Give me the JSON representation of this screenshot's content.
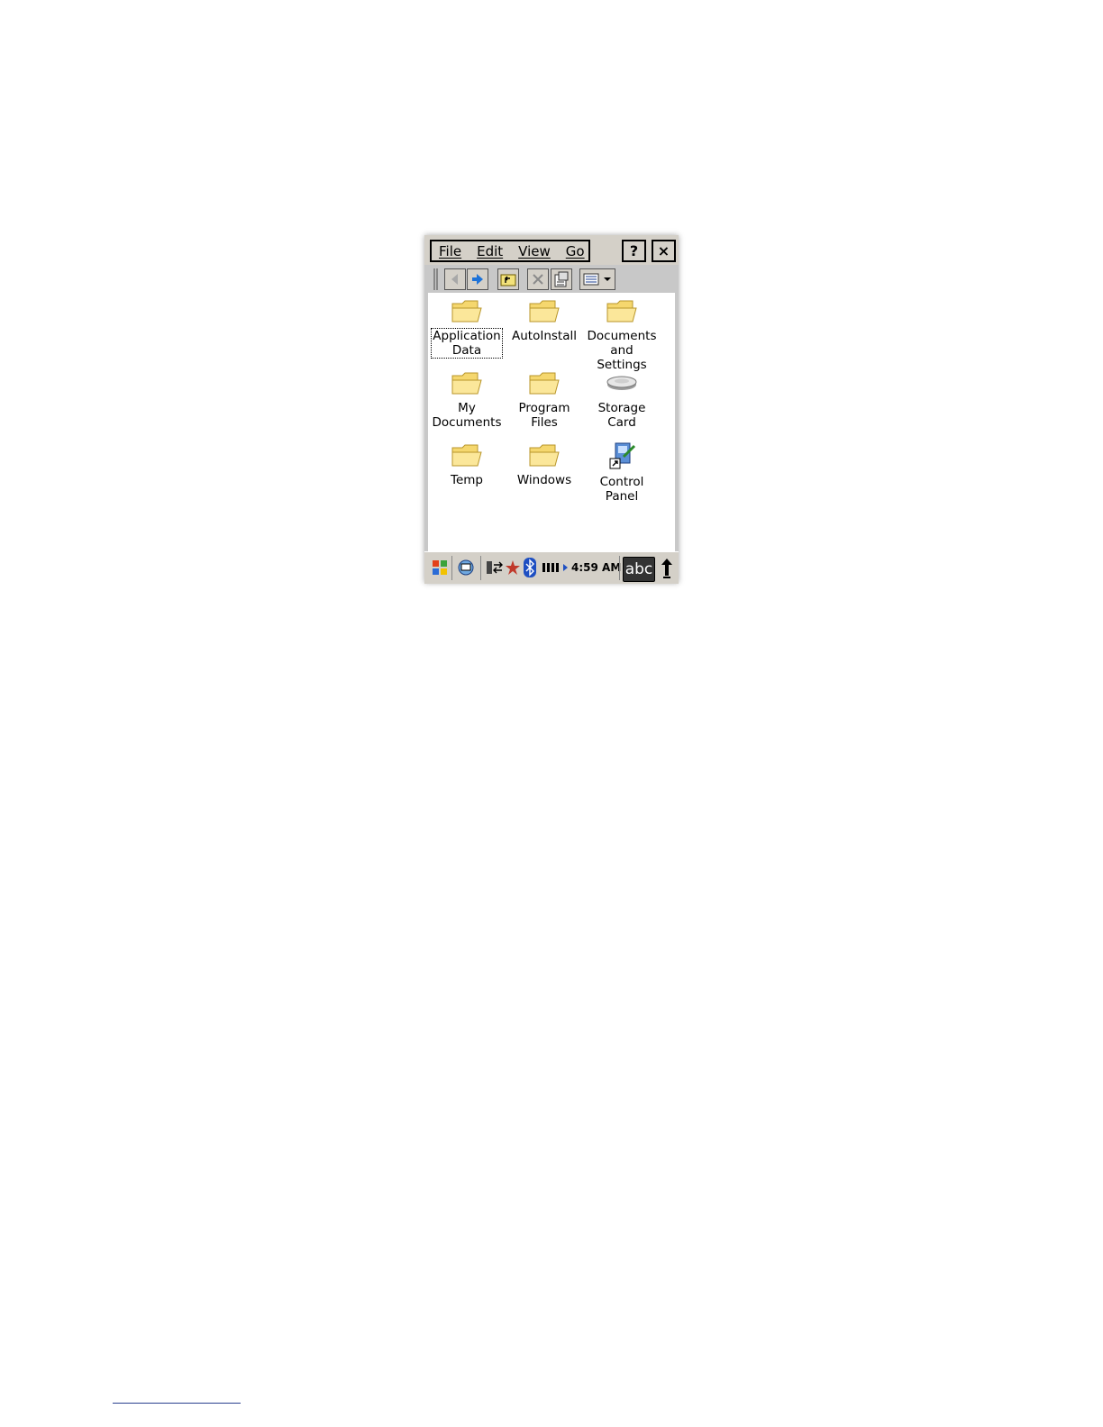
{
  "menu": {
    "items": [
      "File",
      "Edit",
      "View",
      "Go"
    ],
    "help_label": "?",
    "close_label": "×"
  },
  "toolbar": {
    "icons": [
      "back-icon",
      "forward-icon",
      "up-folder-icon",
      "delete-icon",
      "properties-icon",
      "view-menu-icon"
    ]
  },
  "files": [
    {
      "line1": "Application",
      "line2": "Data",
      "icon": "folder-icon"
    },
    {
      "line1": "AutoInstall",
      "line2": "",
      "icon": "folder-icon"
    },
    {
      "line1": "Documents",
      "line2": "and Settings",
      "icon": "folder-icon"
    },
    {
      "line1": "My",
      "line2": "Documents",
      "icon": "folder-icon"
    },
    {
      "line1": "Program Files",
      "line2": "",
      "icon": "folder-icon"
    },
    {
      "line1": "Storage Card",
      "line2": "",
      "icon": "storage-card-icon"
    },
    {
      "line1": "Temp",
      "line2": "",
      "icon": "folder-icon"
    },
    {
      "line1": "Windows",
      "line2": "",
      "icon": "folder-icon"
    },
    {
      "line1": "Control",
      "line2": "Panel",
      "icon": "control-panel-icon"
    }
  ],
  "taskbar": {
    "time": "4:59 AM",
    "input_label": "abc"
  }
}
